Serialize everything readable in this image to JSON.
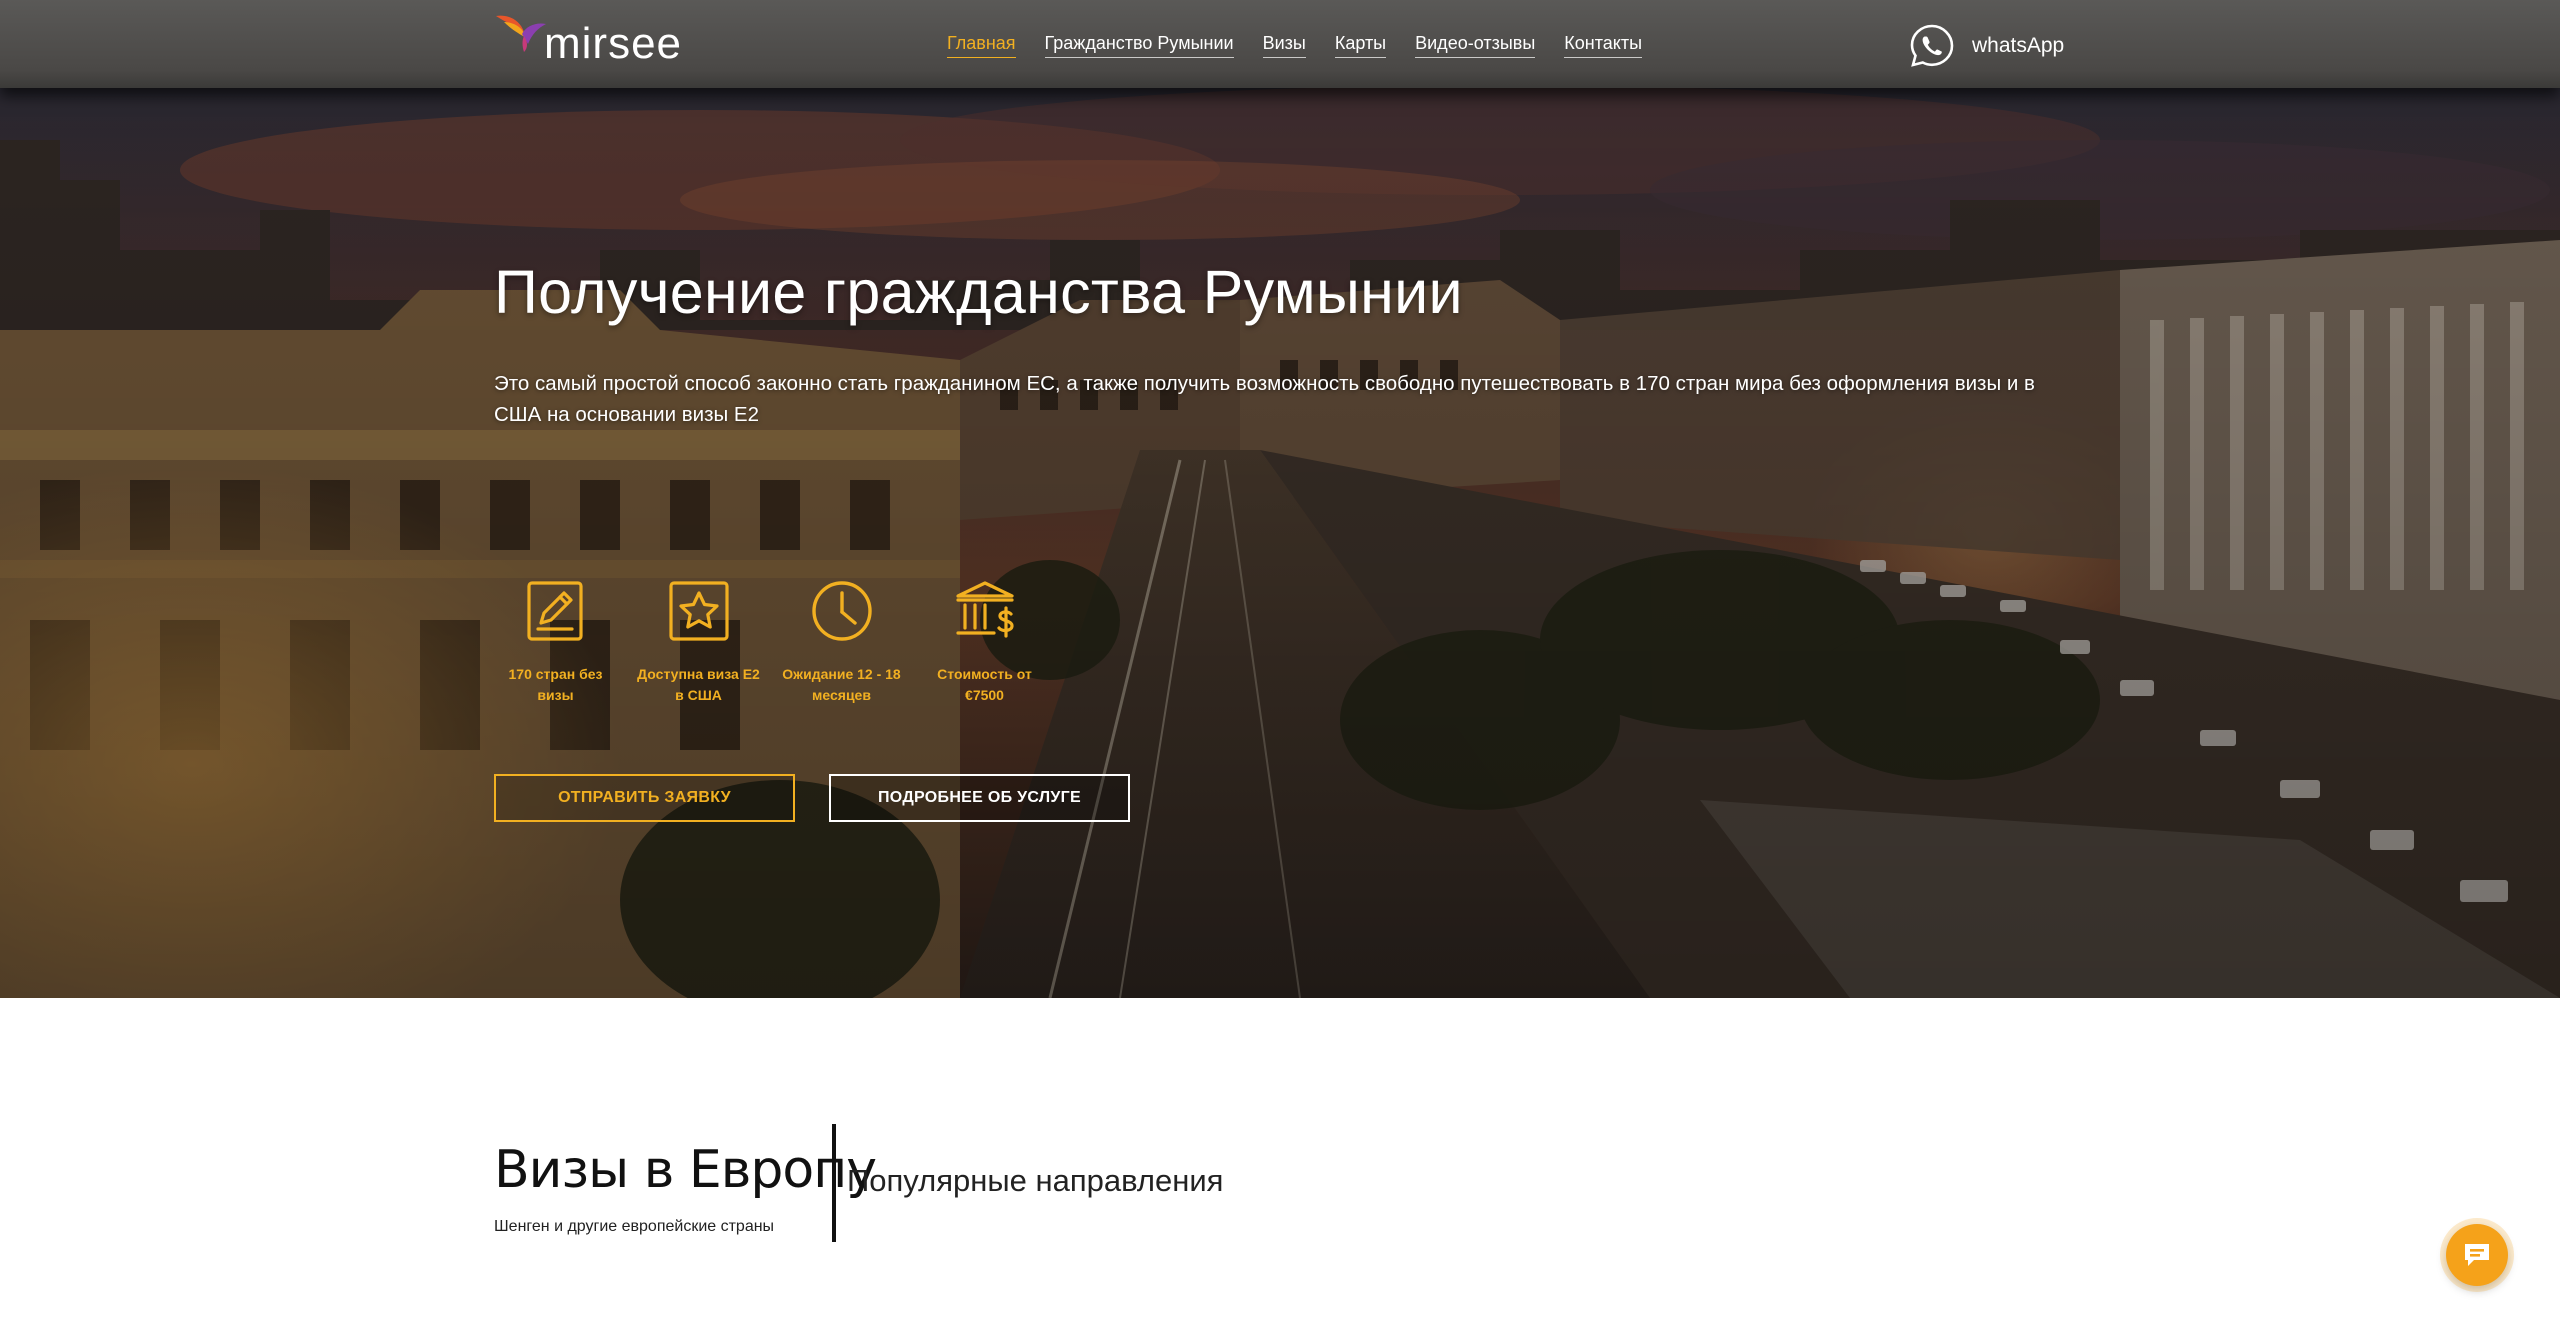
{
  "header": {
    "logo_text": "mirsee",
    "nav": [
      {
        "label": "Главная",
        "active": true
      },
      {
        "label": "Гражданство Румынии",
        "active": false
      },
      {
        "label": "Визы",
        "active": false
      },
      {
        "label": "Карты",
        "active": false
      },
      {
        "label": "Видео-отзывы",
        "active": false
      },
      {
        "label": "Контакты",
        "active": false
      }
    ],
    "contact_label": "whatsApp",
    "contact_icon": "whatsapp-icon"
  },
  "hero": {
    "title": "Получение гражданства Румынии",
    "subtitle": "Это самый простой способ законно стать гражданином ЕС, а также получить возможность свободно путешествовать в 170 стран мира без оформления визы и в США на основании визы Е2",
    "features": [
      {
        "icon": "passport-icon",
        "text": "170 стран без визы"
      },
      {
        "icon": "star-badge-icon",
        "text": "Доступна виза Е2 в США"
      },
      {
        "icon": "clock-icon",
        "text": "Ожидание 12 - 18 месяцев"
      },
      {
        "icon": "bank-dollar-icon",
        "text": "Стоимость от €7500"
      }
    ],
    "primary_button": "ОТПРАВИТЬ ЗАЯВКУ",
    "secondary_button": "ПОДРОБНЕЕ ОБ УСЛУГЕ"
  },
  "section": {
    "title": "Визы в Европу",
    "subtitle": "Шенген и другие европейские страны",
    "right_heading": "Популярные направления"
  },
  "chat": {
    "icon": "chat-icon"
  },
  "colors": {
    "accent": "#f2b021",
    "header_bg": "#4a4846",
    "text_light": "#ffffff",
    "chat_button": "#f5a21a"
  }
}
